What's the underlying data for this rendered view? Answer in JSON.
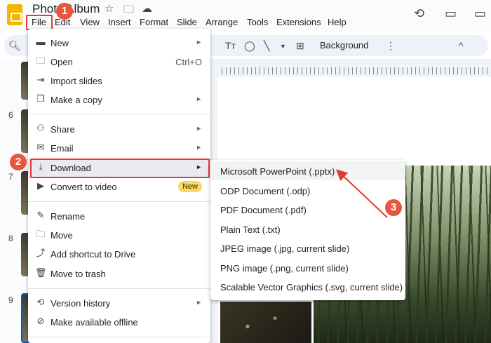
{
  "app": {
    "doc_title": "Photo Album",
    "title_icons": [
      "star-icon",
      "move-to-folder-icon",
      "cloud-saved-icon"
    ],
    "top_right_icons": [
      "version-history-icon",
      "present-comments-icon"
    ]
  },
  "menubar": {
    "items": [
      "File",
      "Edit",
      "View",
      "Insert",
      "Format",
      "Slide",
      "Arrange",
      "Tools",
      "Extensions",
      "Help"
    ]
  },
  "toolbar": {
    "text_style_icon": "Tт",
    "background_label": "Background",
    "more_icon": "⋮",
    "collapse_icon": "^"
  },
  "filmstrip": {
    "slide_numbers": [
      "6",
      "7",
      "8",
      "9"
    ]
  },
  "file_menu": {
    "items": [
      {
        "icon": "new-icon",
        "label": "New",
        "has_submenu": true
      },
      {
        "icon": "open-folder-icon",
        "label": "Open",
        "shortcut": "Ctrl+O"
      },
      {
        "icon": "import-icon",
        "label": "Import slides"
      },
      {
        "icon": "copy-icon",
        "label": "Make a copy",
        "has_submenu": true
      },
      {
        "icon": "share-icon",
        "label": "Share",
        "has_submenu": true
      },
      {
        "icon": "email-icon",
        "label": "Email",
        "has_submenu": true
      },
      {
        "icon": "download-icon",
        "label": "Download",
        "has_submenu": true,
        "highlighted": true
      },
      {
        "icon": "video-icon",
        "label": "Convert to video",
        "badge": "New"
      },
      {
        "icon": "pencil-icon",
        "label": "Rename"
      },
      {
        "icon": "move-icon",
        "label": "Move"
      },
      {
        "icon": "shortcut-icon",
        "label": "Add shortcut to Drive"
      },
      {
        "icon": "trash-icon",
        "label": "Move to trash"
      },
      {
        "icon": "history-icon",
        "label": "Version history",
        "has_submenu": true
      },
      {
        "icon": "offline-icon",
        "label": "Make available offline"
      }
    ]
  },
  "download_submenu": {
    "items": [
      "Microsoft PowerPoint (.pptx)",
      "ODP Document (.odp)",
      "PDF Document (.pdf)",
      "Plain Text (.txt)",
      "JPEG image (.jpg, current slide)",
      "PNG image (.png, current slide)",
      "Scalable Vector Graphics (.svg, current slide)"
    ]
  },
  "callouts": [
    "1",
    "2",
    "3"
  ],
  "colors": {
    "accent_red": "#e53935",
    "callout_fill": "#e8563f",
    "new_badge": "#fdd663",
    "selected_blue": "#0b57d0"
  }
}
